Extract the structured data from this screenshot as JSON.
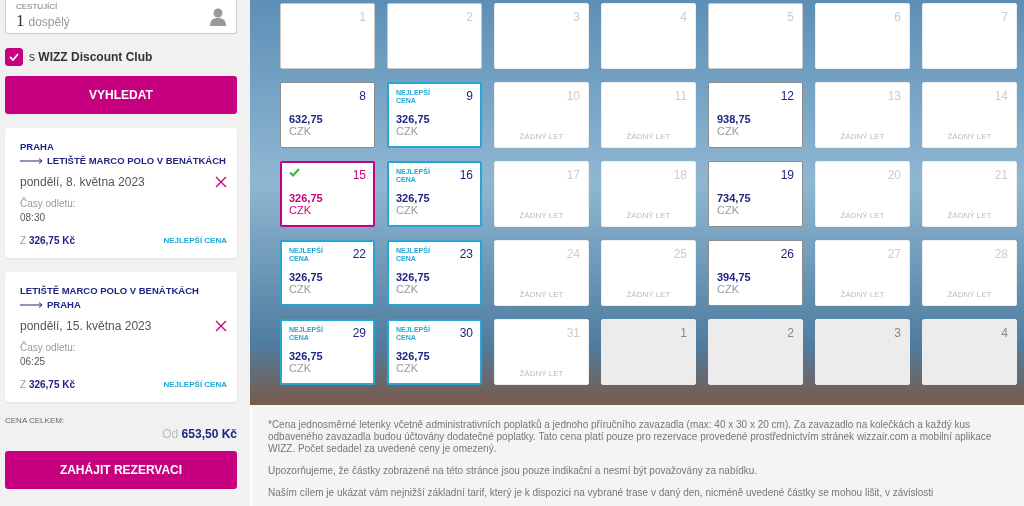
{
  "passengers": {
    "label": "CESTUJÍCÍ",
    "count": "1",
    "unit": "dospělý"
  },
  "discount_club": {
    "prefix": "s",
    "name": "WIZZ Discount Club",
    "checked": true
  },
  "search_button": "VYHLEDAT",
  "flights": [
    {
      "from": "PRAHA",
      "to": "LETIŠTĚ MARCO POLO V BENÁTKÁCH",
      "date": "pondělí, 8. května 2023",
      "times_label": "Časy odletu:",
      "time": "08:30",
      "price_prefix": "Z",
      "price": "326,75 Kč",
      "tag": "NEJLEPŠÍ CENA"
    },
    {
      "from": "LETIŠTĚ MARCO POLO V BENÁTKÁCH",
      "to": "PRAHA",
      "date": "pondělí, 15. května 2023",
      "times_label": "Časy odletu:",
      "time": "06:25",
      "price_prefix": "Z",
      "price": "326,75 Kč",
      "tag": "NEJLEPŠÍ CENA"
    }
  ],
  "total": {
    "label": "CENA CELKEM:",
    "prefix": "Od",
    "amount": "653,50 Kč"
  },
  "book_button": "ZAHÁJIT REZERVACI",
  "calendar": {
    "days": [
      {
        "day": "1",
        "kind": "blank",
        "selected": false
      },
      {
        "day": "2",
        "kind": "blank",
        "selected": false
      },
      {
        "day": "3",
        "kind": "empty",
        "selected": false
      },
      {
        "day": "4",
        "kind": "empty",
        "selected": false
      },
      {
        "day": "5",
        "kind": "blank",
        "selected": false
      },
      {
        "day": "6",
        "kind": "empty",
        "selected": false
      },
      {
        "day": "7",
        "kind": "empty",
        "selected": false
      },
      {
        "day": "8",
        "kind": "available",
        "selected": false,
        "price": "632,75",
        "currency": "CZK"
      },
      {
        "day": "9",
        "kind": "available",
        "selected": false,
        "badge": "NEJLEPŠÍ CENA",
        "price": "326,75",
        "currency": "CZK"
      },
      {
        "day": "10",
        "kind": "unavailable",
        "selected": false,
        "note": "ŽÁDNÝ LET"
      },
      {
        "day": "11",
        "kind": "unavailable",
        "selected": false,
        "note": "ŽÁDNÝ LET"
      },
      {
        "day": "12",
        "kind": "available",
        "selected": false,
        "price": "938,75",
        "currency": "CZK"
      },
      {
        "day": "13",
        "kind": "unavailable",
        "selected": false,
        "note": "ŽÁDNÝ LET"
      },
      {
        "day": "14",
        "kind": "unavailable",
        "selected": false,
        "note": "ŽÁDNÝ LET"
      },
      {
        "day": "15",
        "kind": "available",
        "selected": true,
        "price": "326,75",
        "currency": "CZK"
      },
      {
        "day": "16",
        "kind": "available",
        "selected": false,
        "badge": "NEJLEPŠÍ CENA",
        "price": "326,75",
        "currency": "CZK"
      },
      {
        "day": "17",
        "kind": "unavailable",
        "selected": false,
        "note": "ŽÁDNÝ LET"
      },
      {
        "day": "18",
        "kind": "unavailable",
        "selected": false,
        "note": "ŽÁDNÝ LET"
      },
      {
        "day": "19",
        "kind": "available",
        "selected": false,
        "price": "734,75",
        "currency": "CZK"
      },
      {
        "day": "20",
        "kind": "unavailable",
        "selected": false,
        "note": "ŽÁDNÝ LET"
      },
      {
        "day": "21",
        "kind": "unavailable",
        "selected": false,
        "note": "ŽÁDNÝ LET"
      },
      {
        "day": "22",
        "kind": "available",
        "selected": false,
        "badge": "NEJLEPŠÍ CENA",
        "price": "326,75",
        "currency": "CZK"
      },
      {
        "day": "23",
        "kind": "available",
        "selected": false,
        "badge": "NEJLEPŠÍ CENA",
        "price": "326,75",
        "currency": "CZK"
      },
      {
        "day": "24",
        "kind": "unavailable",
        "selected": false,
        "note": "ŽÁDNÝ LET"
      },
      {
        "day": "25",
        "kind": "unavailable",
        "selected": false,
        "note": "ŽÁDNÝ LET"
      },
      {
        "day": "26",
        "kind": "available",
        "selected": false,
        "price": "394,75",
        "currency": "CZK"
      },
      {
        "day": "27",
        "kind": "unavailable",
        "selected": false,
        "note": "ŽÁDNÝ LET"
      },
      {
        "day": "28",
        "kind": "unavailable",
        "selected": false,
        "note": "ŽÁDNÝ LET"
      },
      {
        "day": "29",
        "kind": "available",
        "selected": false,
        "badge": "NEJLEPŠÍ CENA",
        "price": "326,75",
        "currency": "CZK"
      },
      {
        "day": "30",
        "kind": "available",
        "selected": false,
        "badge": "NEJLEPŠÍ CENA",
        "price": "326,75",
        "currency": "CZK"
      },
      {
        "day": "31",
        "kind": "unavailable",
        "selected": false,
        "note": "ŽÁDNÝ LET"
      },
      {
        "day": "1",
        "kind": "outside",
        "selected": false
      },
      {
        "day": "2",
        "kind": "outside",
        "selected": false
      },
      {
        "day": "3",
        "kind": "outside",
        "selected": false
      },
      {
        "day": "4",
        "kind": "outside",
        "selected": false
      }
    ]
  },
  "disclaimer": [
    "*Cena jednosměrné letenky včetně administrativních poplatků a jednoho příručního zavazadla (max: 40 x 30 x 20 cm). Za zavazadlo na kolečkách a každý kus odbaveného zavazadla budou účtovány dodatečné poplatky. Tato cena platí pouze pro rezervace provedené prostřednictvím stránek wizzair.com a mobilní aplikace WIZZ. Počet sedadel za uvedené ceny je omezený.",
    "Upozorňujeme, že částky zobrazené na této stránce jsou pouze indikační a nesmí být považovány za nabídku.",
    "Naším cílem je ukázat vám nejnižší základní tarif, který je k dispozici na vybrané trase v daný den, nicméně uvedené částky se mohou lišit, v závislosti"
  ]
}
